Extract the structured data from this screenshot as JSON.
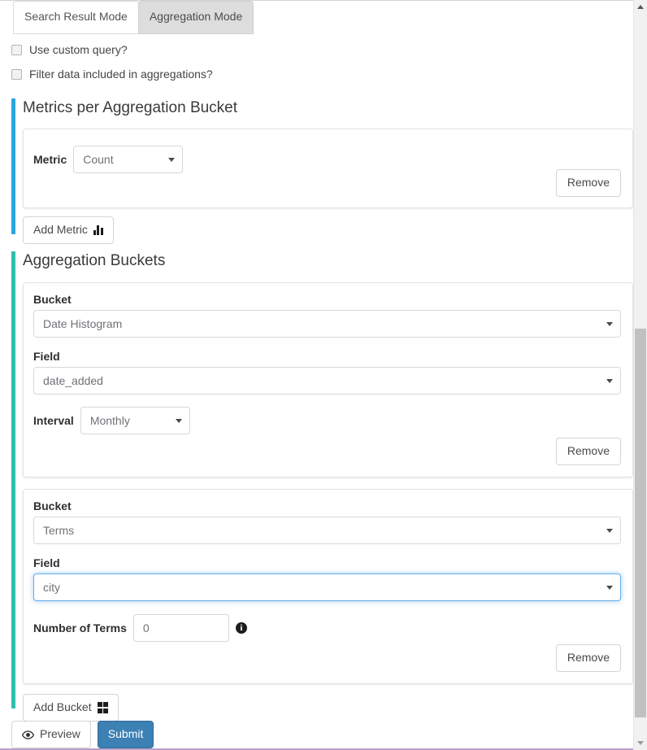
{
  "tabs": [
    {
      "label": "Search Result Mode",
      "active": false
    },
    {
      "label": "Aggregation Mode",
      "active": true
    }
  ],
  "checkboxes": [
    {
      "label": "Use custom query?",
      "checked": false
    },
    {
      "label": "Filter data included in aggregations?",
      "checked": false
    }
  ],
  "metrics_section": {
    "title": "Metrics per Aggregation Bucket",
    "accent_color": "#29a5dd",
    "metric": {
      "label": "Metric",
      "value": "Count"
    },
    "remove_label": "Remove",
    "add_label": "Add Metric",
    "add_icon": "bar-chart-icon"
  },
  "buckets_section": {
    "title": "Aggregation Buckets",
    "accent_color": "#2ebfad",
    "buckets": [
      {
        "bucket_label": "Bucket",
        "bucket_value": "Date Histogram",
        "field_label": "Field",
        "field_value": "date_added",
        "field_focused": false,
        "interval_label": "Interval",
        "interval_value": "Monthly",
        "remove_label": "Remove"
      },
      {
        "bucket_label": "Bucket",
        "bucket_value": "Terms",
        "field_label": "Field",
        "field_value": "city",
        "field_focused": true,
        "terms_label": "Number of Terms",
        "terms_value": "0",
        "terms_info_icon": "info-icon",
        "remove_label": "Remove"
      }
    ],
    "add_label": "Add Bucket",
    "add_icon": "grid-icon"
  },
  "footer": {
    "preview_label": "Preview",
    "preview_icon": "eye-icon",
    "submit_label": "Submit",
    "submit_color": "#3c80b4"
  },
  "scrollbar": {
    "up_icon": "scroll-up-arrow-icon",
    "down_icon": "scroll-down-arrow-icon"
  }
}
